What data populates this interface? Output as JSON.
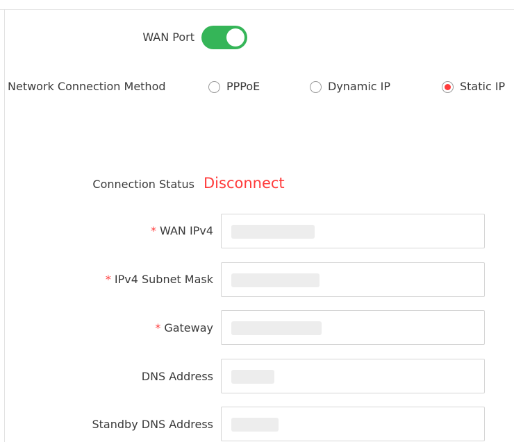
{
  "wan_port": {
    "label": "WAN Port",
    "enabled": true,
    "accent_color": "#35b558"
  },
  "connection_method": {
    "label": "Network Connection Method",
    "options": [
      "PPPoE",
      "Dynamic IP",
      "Static IP"
    ],
    "selected": "Static IP",
    "accent_color": "#ff3b3b"
  },
  "connection_status": {
    "label": "Connection Status",
    "value": "Disconnect",
    "value_color": "#ff3b3b"
  },
  "fields": {
    "wan_ipv4": {
      "required_mark": "*",
      "label": "WAN IPv4"
    },
    "subnet_mask": {
      "required_mark": "*",
      "label": "IPv4 Subnet Mask"
    },
    "gateway": {
      "required_mark": "*",
      "label": "Gateway"
    },
    "dns": {
      "label": "DNS Address"
    },
    "standby_dns": {
      "label": "Standby DNS Address"
    }
  }
}
